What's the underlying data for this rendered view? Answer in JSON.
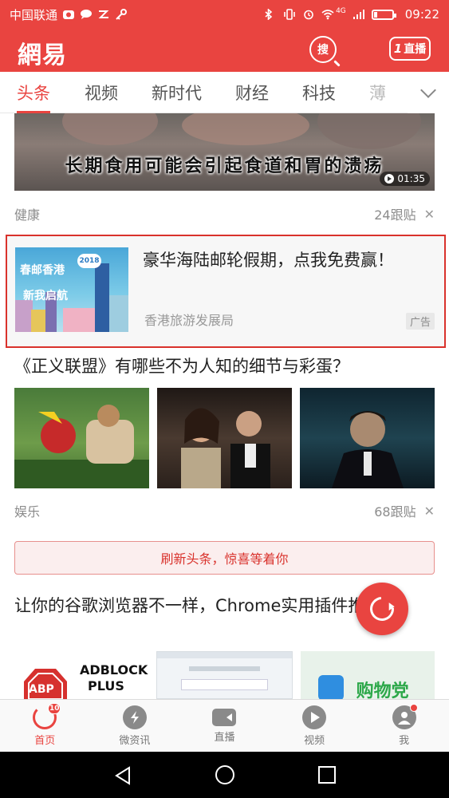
{
  "status_bar": {
    "carrier": "中国联通",
    "network": "4G",
    "time": "09:22"
  },
  "header": {
    "logo": "網易",
    "search_label": "搜",
    "live_count": "1",
    "live_label": "直播"
  },
  "tabs": [
    "头条",
    "视频",
    "新时代",
    "财经",
    "科技",
    "薄"
  ],
  "active_tab": "头条",
  "feed": {
    "video": {
      "caption": "长期食用可能会引起食道和胃的溃疡",
      "duration": "01:35",
      "category": "健康",
      "comments": "24跟贴"
    },
    "ad": {
      "image_text_1": "春邮香港",
      "image_text_2": "新我启航",
      "image_year": "2018",
      "title": "豪华海陆邮轮假期，点我免费赢！",
      "source": "香港旅游发展局",
      "badge": "广告"
    },
    "article1": {
      "title": "《正义联盟》有哪些不为人知的细节与彩蛋？",
      "category": "娱乐",
      "comments": "68跟贴"
    },
    "refresh_bar": "刷新头条，惊喜等着你",
    "article2": {
      "title": "让你的谷歌浏览器不一样，Chrome实用插件推荐",
      "thumb1_text_a": "ABP",
      "thumb1_text_b": "ADBLOCK",
      "thumb1_text_c": "PLUS",
      "thumb3_text": "购物党"
    }
  },
  "bottom_nav": {
    "items": [
      {
        "label": "首页",
        "icon": "refresh-icon",
        "badge": "10"
      },
      {
        "label": "微资讯",
        "icon": "lightning-icon"
      },
      {
        "label": "直播",
        "icon": "video-camera-icon"
      },
      {
        "label": "视频",
        "icon": "play-icon"
      },
      {
        "label": "我",
        "icon": "user-icon"
      }
    ]
  },
  "colors": {
    "brand_red": "#e94440",
    "ad_border": "#d9322c"
  }
}
